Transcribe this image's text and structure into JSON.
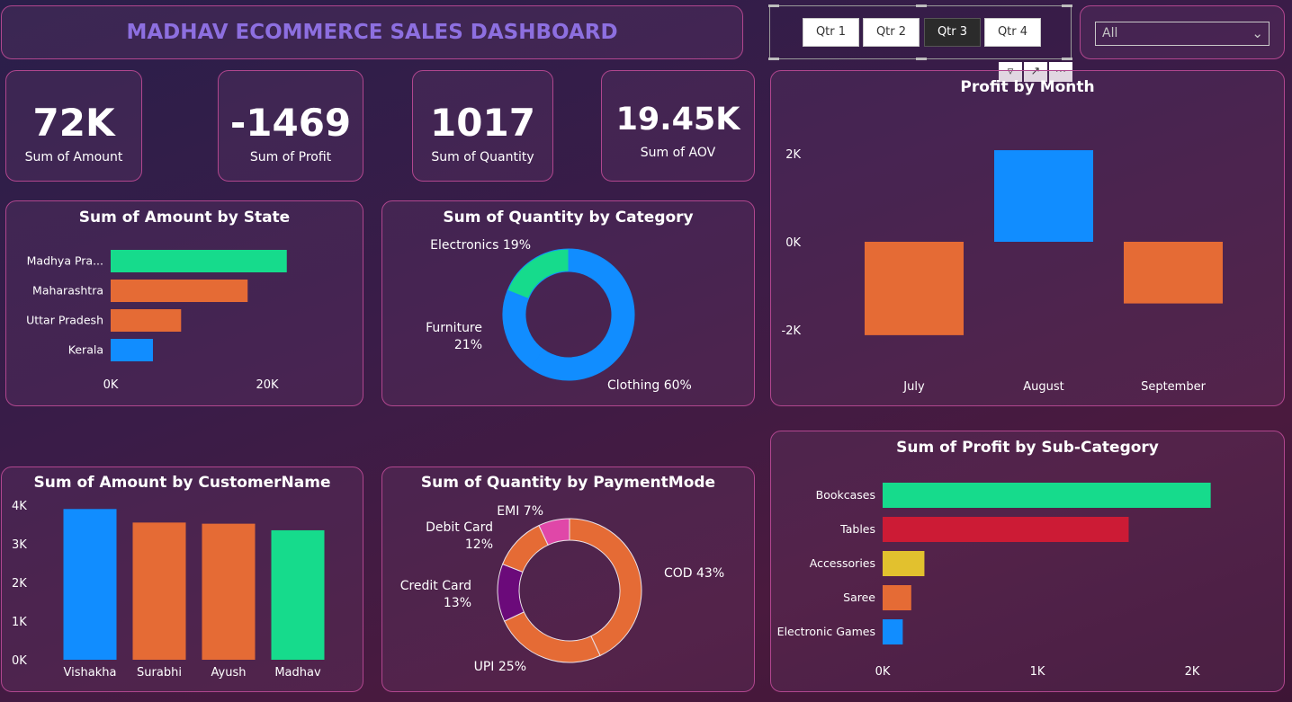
{
  "header": {
    "title": "MADHAV ECOMMERCE SALES DASHBOARD"
  },
  "slicer": {
    "quarters": [
      "Qtr 1",
      "Qtr 2",
      "Qtr 3",
      "Qtr 4"
    ],
    "selected": "Qtr 3",
    "dropdown_value": "All"
  },
  "kpis": [
    {
      "value": "72K",
      "label": "Sum of Amount"
    },
    {
      "value": "-1469",
      "label": "Sum of Profit"
    },
    {
      "value": "1017",
      "label": "Sum of Quantity"
    },
    {
      "value": "19.45K",
      "label": "Sum of AOV"
    }
  ],
  "colors": {
    "green": "#16db8c",
    "orange": "#e56b35",
    "blue": "#118dff",
    "red": "#cc1b35",
    "yellow": "#e2c12e",
    "purple": "#6b0a7a",
    "pink": "#e047a8",
    "panel_border": "#b0468e",
    "title_purple": "#8d6fe0"
  },
  "chart_data": [
    {
      "id": "amount_by_state",
      "type": "bar",
      "orientation": "horizontal",
      "title": "Sum of Amount by State",
      "categories": [
        "Madhya Pra...",
        "Maharashtra",
        "Uttar Pradesh",
        "Kerala"
      ],
      "values": [
        22500,
        17500,
        9000,
        5400
      ],
      "colors": [
        "#16db8c",
        "#e56b35",
        "#e56b35",
        "#118dff"
      ],
      "xticks": [
        "0K",
        "20K"
      ],
      "xtick_values": [
        0,
        20000
      ],
      "xlim": [
        0,
        20000
      ]
    },
    {
      "id": "quantity_by_category",
      "type": "pie",
      "donut": true,
      "title": "Sum of Quantity by Category",
      "labels": [
        "Clothing",
        "Furniture",
        "Electronics"
      ],
      "values": [
        60,
        21,
        19
      ],
      "display": [
        "Clothing 60%",
        "Furniture",
        "21%",
        "Electronics 19%"
      ],
      "colors": [
        "#118dff",
        "#118dff",
        "#16db8c"
      ]
    },
    {
      "id": "profit_by_month",
      "type": "bar",
      "title": "Profit by Month",
      "categories": [
        "July",
        "August",
        "September"
      ],
      "values": [
        -2120,
        2080,
        -1400
      ],
      "colors": [
        "#e56b35",
        "#118dff",
        "#e56b35"
      ],
      "yticks": [
        "2K",
        "0K",
        "-2K"
      ],
      "ytick_values": [
        2000,
        0,
        -2000
      ]
    },
    {
      "id": "amount_by_customer",
      "type": "bar",
      "title": "Sum of Amount by CustomerName",
      "categories": [
        "Vishakha",
        "Surabhi",
        "Ayush",
        "Madhav"
      ],
      "values": [
        3900,
        3550,
        3520,
        3350
      ],
      "colors": [
        "#118dff",
        "#e56b35",
        "#e56b35",
        "#16db8c"
      ],
      "yticks": [
        "4K",
        "3K",
        "2K",
        "1K",
        "0K"
      ],
      "ytick_values": [
        4000,
        3000,
        2000,
        1000,
        0
      ]
    },
    {
      "id": "quantity_by_paymentmode",
      "type": "pie",
      "donut": true,
      "title": "Sum of Quantity by PaymentMode",
      "labels": [
        "COD",
        "UPI",
        "Credit Card",
        "Debit Card",
        "EMI"
      ],
      "values": [
        43,
        25,
        13,
        12,
        7
      ],
      "display": [
        "COD 43%",
        "UPI 25%",
        "Credit Card",
        "13%",
        "Debit Card",
        "12%",
        "EMI 7%"
      ],
      "colors": [
        "#e56b35",
        "#e56b35",
        "#6b0a7a",
        "#e56b35",
        "#e047a8"
      ]
    },
    {
      "id": "profit_by_subcategory",
      "type": "bar",
      "orientation": "horizontal",
      "title": "Sum of Profit by Sub-Category",
      "categories": [
        "Bookcases",
        "Tables",
        "Accessories",
        "Saree",
        "Electronic Games"
      ],
      "values": [
        2120,
        1590,
        270,
        185,
        130
      ],
      "colors": [
        "#16db8c",
        "#cc1b35",
        "#e2c12e",
        "#e56b35",
        "#118dff"
      ],
      "xticks": [
        "0K",
        "1K",
        "2K"
      ],
      "xtick_values": [
        0,
        1000,
        2000
      ]
    }
  ]
}
